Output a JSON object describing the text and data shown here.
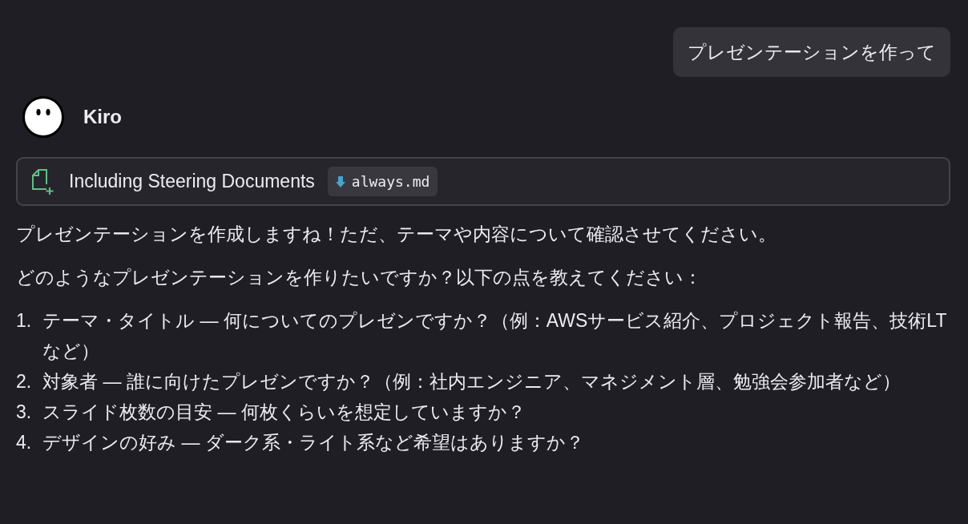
{
  "user_message": "プレゼンテーションを作って",
  "assistant": {
    "name": "Kiro"
  },
  "steering": {
    "label": "Including Steering Documents",
    "files": [
      "always.md"
    ]
  },
  "paragraphs": [
    "プレゼンテーションを作成しますね！ただ、テーマや内容について確認させてください。",
    "どのようなプレゼンテーションを作りたいですか？以下の点を教えてください："
  ],
  "questions": [
    {
      "number": "1.",
      "text": "テーマ・タイトル — 何についてのプレゼンですか？（例：AWSサービス紹介、プロジェクト報告、技術LTなど）"
    },
    {
      "number": "2.",
      "text": "対象者 — 誰に向けたプレゼンですか？（例：社内エンジニア、マネジメント層、勉強会参加者など）"
    },
    {
      "number": "3.",
      "text": "スライド枚数の目安 — 何枚くらいを想定していますか？"
    },
    {
      "number": "4.",
      "text": "デザインの好み — ダーク系・ライト系など希望はありますか？"
    }
  ]
}
